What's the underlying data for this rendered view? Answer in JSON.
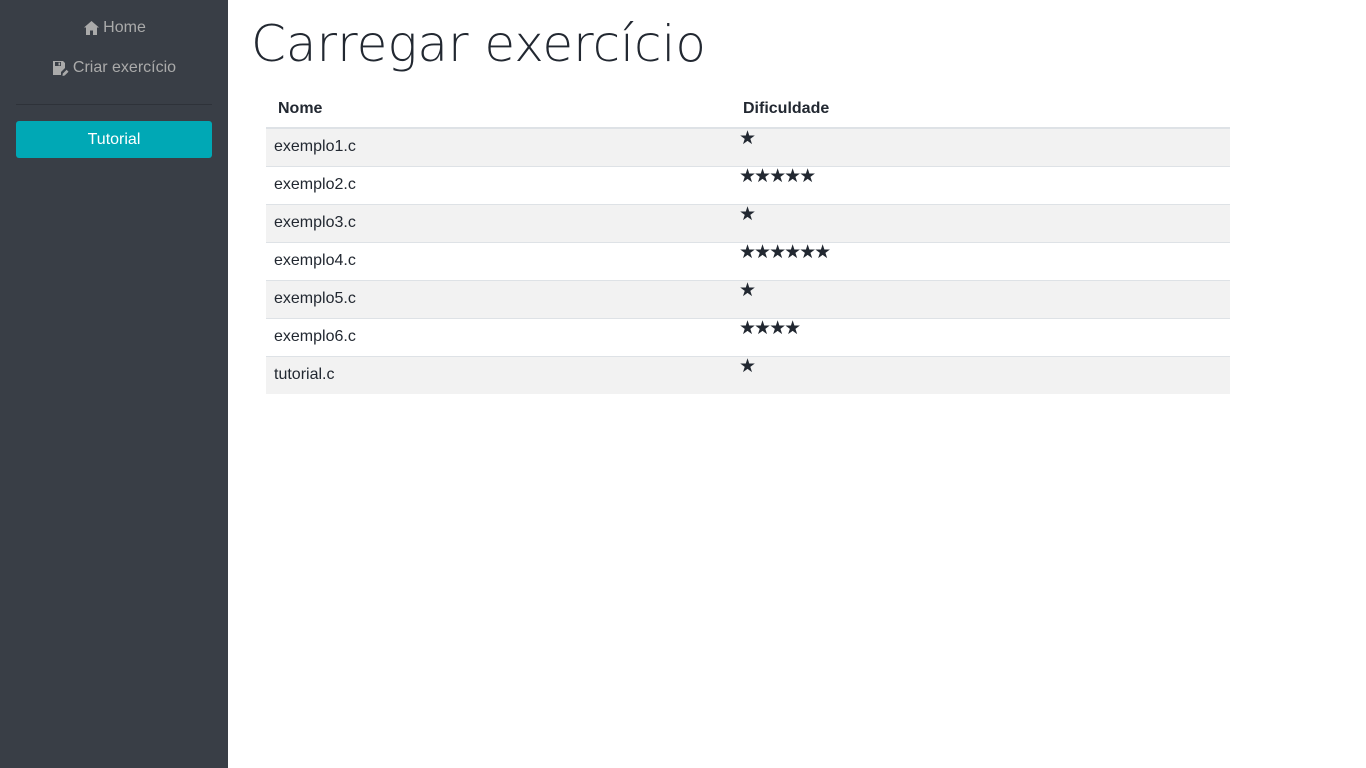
{
  "sidebar": {
    "home_label": "Home",
    "create_label": "Criar exercício",
    "tutorial_label": "Tutorial",
    "home_icon": "home-icon",
    "create_icon": "save-edit-icon"
  },
  "page": {
    "title": "Carregar exercício"
  },
  "table": {
    "headers": [
      "Nome",
      "Dificuldade"
    ],
    "rows": [
      {
        "name": "exemplo1.c",
        "difficulty": 1,
        "stars": "★"
      },
      {
        "name": "exemplo2.c",
        "difficulty": 5,
        "stars": "★★★★★"
      },
      {
        "name": "exemplo3.c",
        "difficulty": 1,
        "stars": "★"
      },
      {
        "name": "exemplo4.c",
        "difficulty": 6,
        "stars": "★★★★★★"
      },
      {
        "name": "exemplo5.c",
        "difficulty": 1,
        "stars": "★"
      },
      {
        "name": "exemplo6.c",
        "difficulty": 4,
        "stars": "★★★★"
      },
      {
        "name": "tutorial.c",
        "difficulty": 1,
        "stars": "★"
      }
    ]
  },
  "colors": {
    "sidebar_bg": "#393e46",
    "accent": "#00a8b5",
    "text": "#222831",
    "row_stripe": "#f2f2f2"
  }
}
